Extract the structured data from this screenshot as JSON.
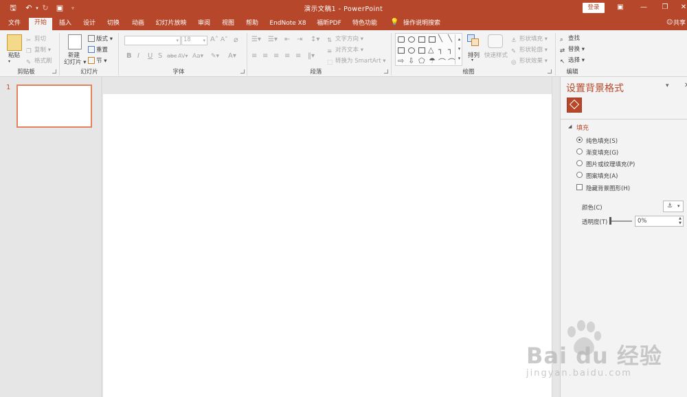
{
  "window": {
    "title": "演示文稿1 - PowerPoint",
    "login": "登录",
    "share": "共享"
  },
  "tabs": [
    "文件",
    "开始",
    "插入",
    "设计",
    "切换",
    "动画",
    "幻灯片放映",
    "审阅",
    "视图",
    "帮助",
    "EndNote X8",
    "福昕PDF",
    "特色功能"
  ],
  "tell_me": "操作说明搜索",
  "ribbon": {
    "clipboard": {
      "label": "剪贴板",
      "paste": "粘贴",
      "cut": "剪切",
      "copy": "复制",
      "format_painter": "格式刷"
    },
    "slides": {
      "label": "幻灯片",
      "new_slide_l1": "新建",
      "new_slide_l2": "幻灯片",
      "layout": "版式",
      "reset": "重置",
      "section": "节"
    },
    "font": {
      "label": "字体",
      "size": "18",
      "bold": "B",
      "italic": "I",
      "underline": "U",
      "shadow": "S",
      "strike": "abc",
      "spacing": "AV",
      "case": "Aa",
      "grow": "A",
      "shrink": "A",
      "color": "A"
    },
    "paragraph": {
      "label": "段落",
      "text_direction": "文字方向",
      "align_text": "对齐文本",
      "smartart": "转换为 SmartArt"
    },
    "drawing": {
      "label": "绘图",
      "arrange": "排列",
      "quick_styles": "快速样式",
      "shape_fill": "形状填充",
      "shape_outline": "形状轮廓",
      "shape_effects": "形状效果"
    },
    "editing": {
      "label": "编辑",
      "find": "查找",
      "replace": "替换",
      "select": "选择"
    }
  },
  "thumbnails": {
    "slide_number": "1"
  },
  "format_pane": {
    "title": "设置背景格式",
    "section": "填充",
    "options": [
      "纯色填充(S)",
      "渐变填充(G)",
      "图片或纹理填充(P)",
      "图案填充(A)"
    ],
    "selected_option": 0,
    "hide_graphics": "隐藏背景图形(H)",
    "color_label": "颜色(C)",
    "transparency_label": "透明度(T)",
    "transparency_value": "0%"
  },
  "watermark": {
    "text": "Bai du 经验",
    "url": "jingyan.baidu.com"
  },
  "colors": {
    "accent": "#b7472a",
    "ribbon_bg": "#f3f3f3",
    "workspace": "#e6e6e6"
  }
}
